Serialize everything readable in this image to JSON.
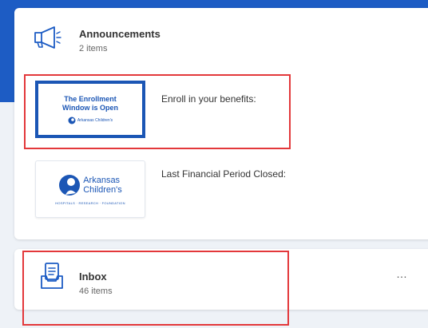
{
  "announcements": {
    "title": "Announcements",
    "count_label": "2 items",
    "icon": "megaphone-icon",
    "items": [
      {
        "label": "Enroll in your benefits:",
        "thumbnail_text_line1": "The Enrollment",
        "thumbnail_text_line2": "Window is Open",
        "thumbnail_logo_text": "Arkansas Children's"
      },
      {
        "label": "Last Financial Period Closed:",
        "thumbnail_org_line1": "Arkansas",
        "thumbnail_org_line2": "Children's",
        "thumbnail_tagline": "HOSPITALS · RESEARCH · FOUNDATION"
      }
    ]
  },
  "inbox": {
    "title": "Inbox",
    "count_label": "46 items",
    "icon": "inbox-tray-icon",
    "more_label": "…"
  },
  "colors": {
    "brand_blue": "#1d5cc4",
    "highlight_red": "#e3383b",
    "card_bg": "#ffffff",
    "page_bg": "#eef2f7"
  }
}
